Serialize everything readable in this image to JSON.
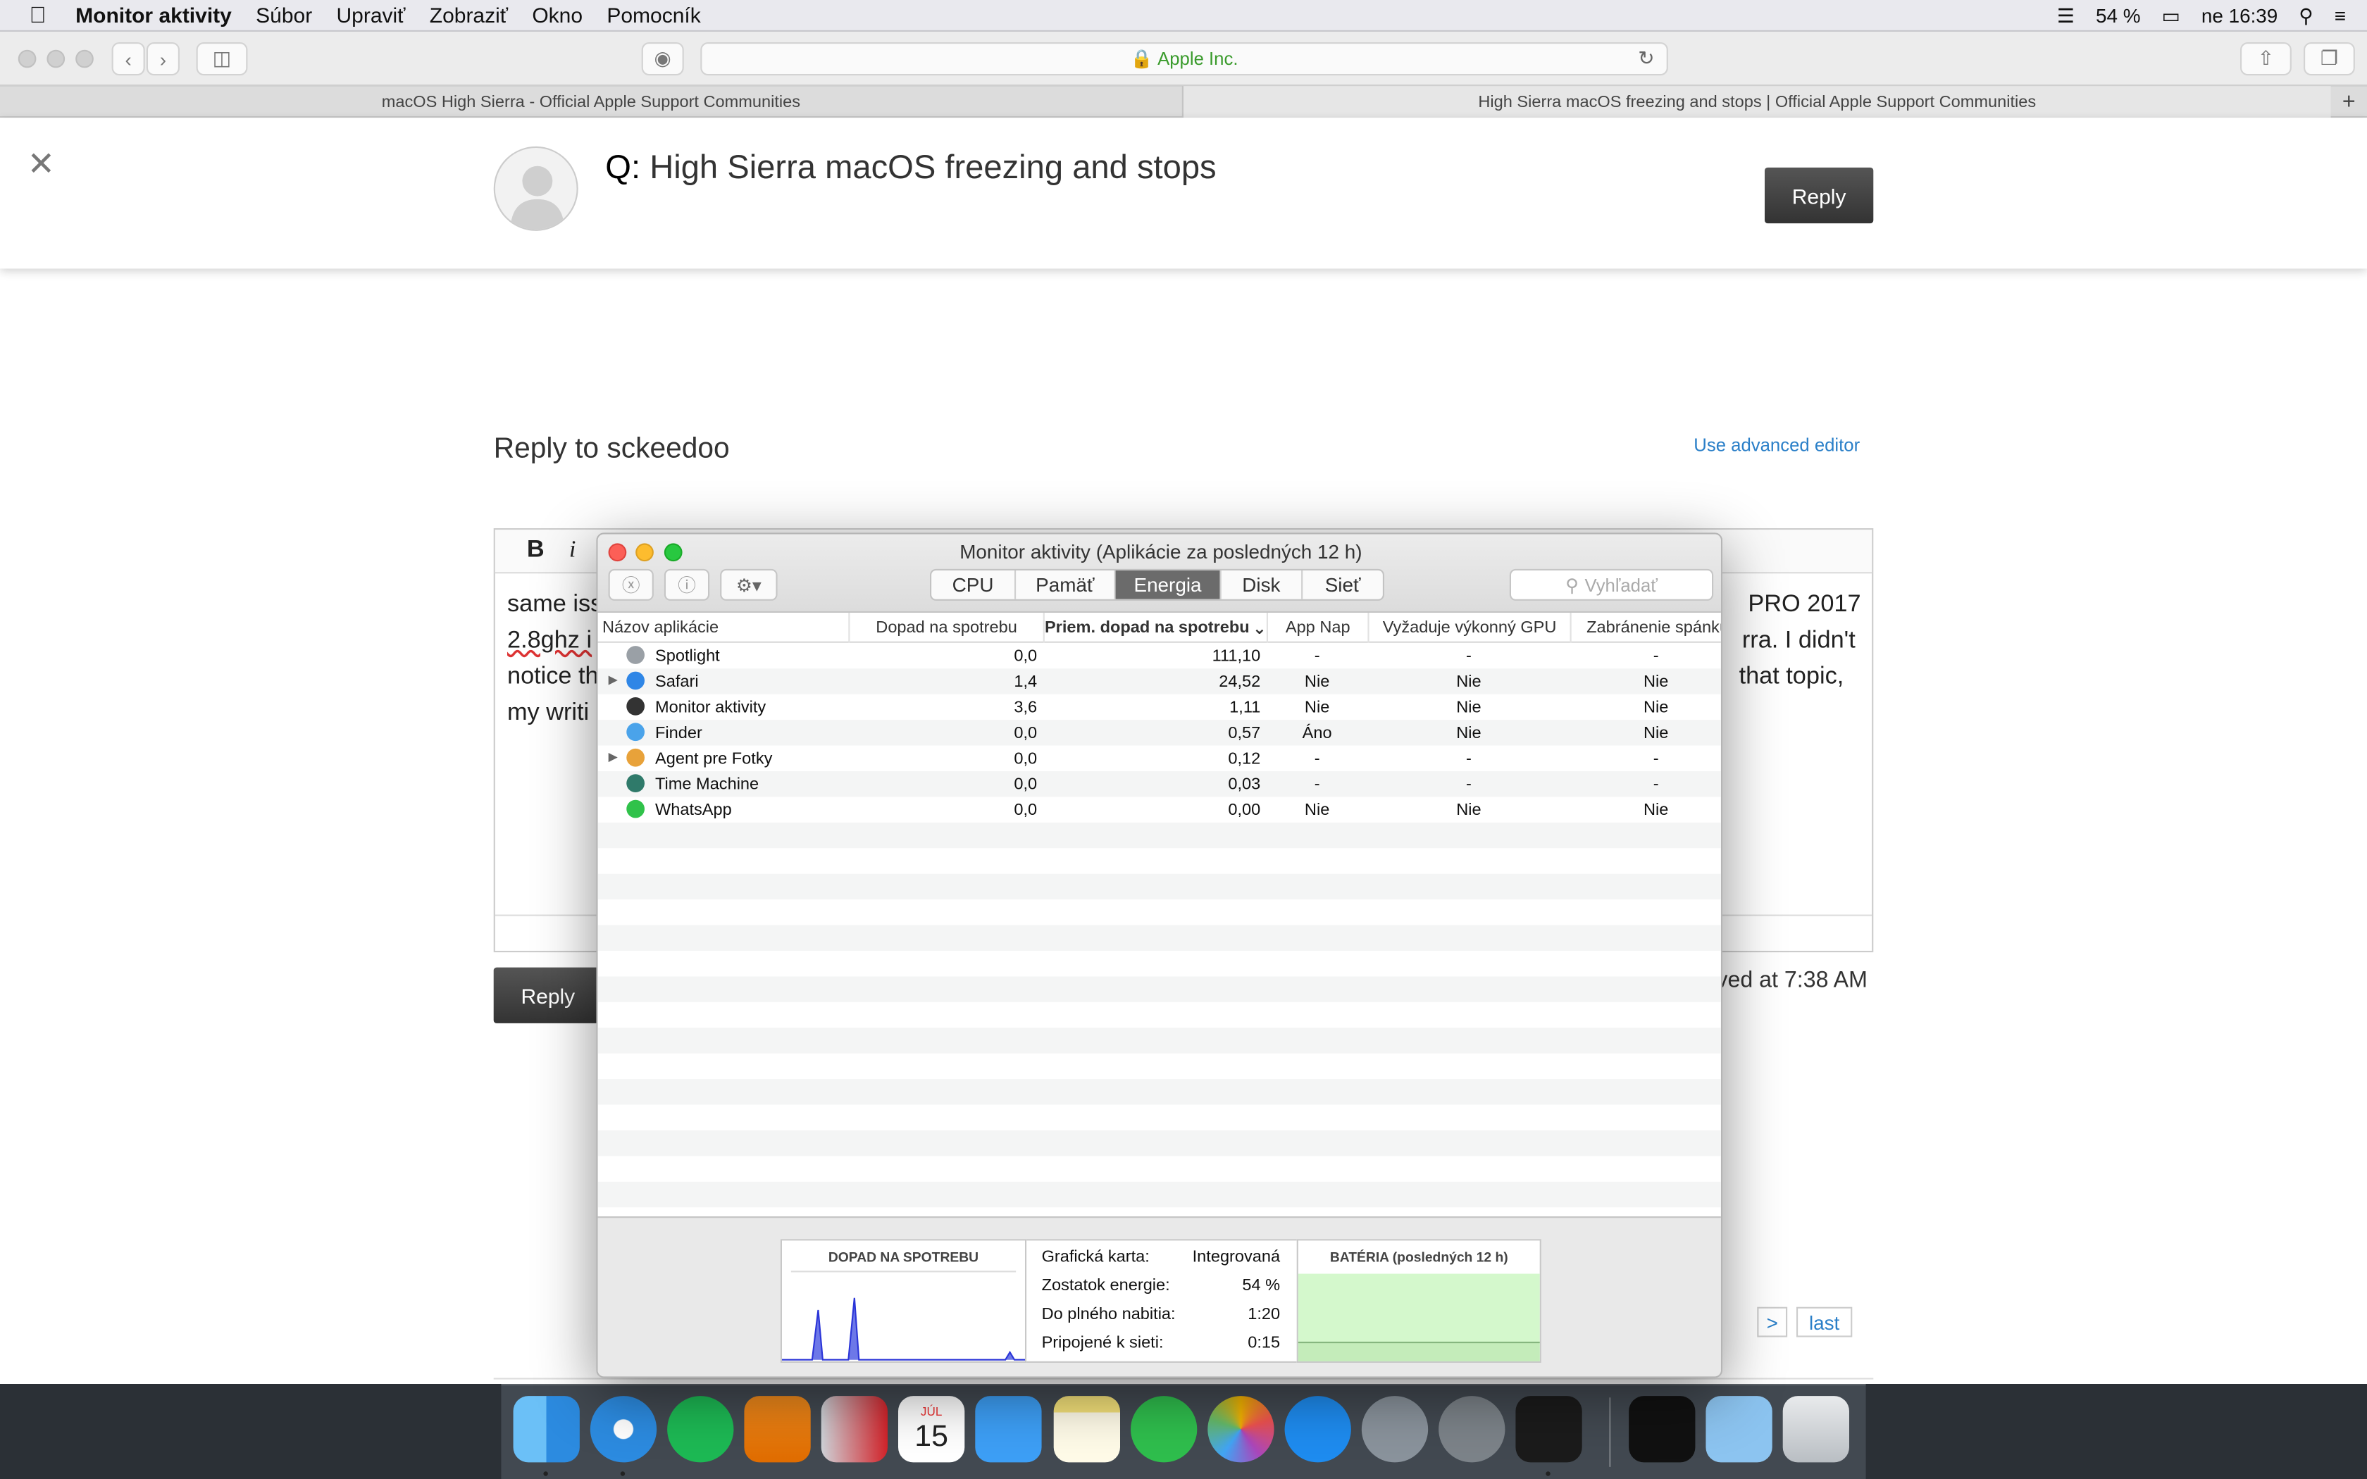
{
  "menubar": {
    "app": "Monitor aktivity",
    "items": [
      "Súbor",
      "Upraviť",
      "Zobraziť",
      "Okno",
      "Pomocník"
    ],
    "battery": "54 %",
    "clock": "ne 16:39"
  },
  "safari": {
    "url": "Apple Inc.",
    "tabs": [
      "macOS High Sierra - Official Apple Support Communities",
      "High Sierra macOS freezing and stops | Official Apple Support Communities"
    ]
  },
  "page": {
    "question_prefix": "Q:",
    "question": "High Sierra macOS freezing and stops",
    "reply_button": "Reply",
    "reply_to": "Reply to sckeedoo",
    "advanced_editor": "Use advanced editor",
    "editor_lines_left": [
      "same iss",
      "2.8ghz i",
      "notice th",
      "my writi"
    ],
    "editor_lines_right": [
      "PRO 2017",
      "rra. I didn't",
      "that topic,",
      ""
    ],
    "bold_button": "B",
    "italic_button": "i",
    "saved_text": "ved at 7:38 AM",
    "pager_prev": ")",
    "pager_next": ">",
    "pager_last": "last"
  },
  "activity_monitor": {
    "title": "Monitor aktivity (Aplikácie za posledných 12 h)",
    "tabs": [
      {
        "label": "CPU",
        "active": false
      },
      {
        "label": "Pamäť",
        "active": false
      },
      {
        "label": "Energia",
        "active": true
      },
      {
        "label": "Disk",
        "active": false
      },
      {
        "label": "Sieť",
        "active": false
      }
    ],
    "search_placeholder": "Vyhľadať",
    "columns": [
      "Názov aplikácie",
      "Dopad na spotrebu",
      "Priem. dopad na spotrebu",
      "App Nap",
      "Vyžaduje výkonný GPU",
      "Zabránenie spánku"
    ],
    "rows": [
      {
        "name": "Spotlight",
        "impact": "0,0",
        "avg": "111,10",
        "nap": "-",
        "gpu": "-",
        "sleep": "-",
        "icon_color": "#9aa0a6",
        "expand": false
      },
      {
        "name": "Safari",
        "impact": "1,4",
        "avg": "24,52",
        "nap": "Nie",
        "gpu": "Nie",
        "sleep": "Nie",
        "icon_color": "#2f86e6",
        "expand": true
      },
      {
        "name": "Monitor aktivity",
        "impact": "3,6",
        "avg": "1,11",
        "nap": "Nie",
        "gpu": "Nie",
        "sleep": "Nie",
        "icon_color": "#333333",
        "expand": false
      },
      {
        "name": "Finder",
        "impact": "0,0",
        "avg": "0,57",
        "nap": "Áno",
        "gpu": "Nie",
        "sleep": "Nie",
        "icon_color": "#4aa3ea",
        "expand": false
      },
      {
        "name": "Agent pre Fotky",
        "impact": "0,0",
        "avg": "0,12",
        "nap": "-",
        "gpu": "-",
        "sleep": "-",
        "icon_color": "#e8a23a",
        "expand": true
      },
      {
        "name": "Time Machine",
        "impact": "0,0",
        "avg": "0,03",
        "nap": "-",
        "gpu": "-",
        "sleep": "-",
        "icon_color": "#2f7a6a",
        "expand": false
      },
      {
        "name": "WhatsApp",
        "impact": "0,0",
        "avg": "0,00",
        "nap": "Nie",
        "gpu": "Nie",
        "sleep": "Nie",
        "icon_color": "#30c24a",
        "expand": false
      }
    ],
    "bottom": {
      "impact_title": "DOPAD NA SPOTREBU",
      "info": [
        {
          "k": "Grafická karta:",
          "v": "Integrovaná"
        },
        {
          "k": "Zostatok energie:",
          "v": "54 %"
        },
        {
          "k": "Do plného nabitia:",
          "v": "1:20"
        },
        {
          "k": "Pripojené k sieti:",
          "v": "0:15"
        }
      ],
      "battery_title": "BATÉRIA (posledných 12 h)",
      "battery_level_fraction": 0.54
    }
  },
  "dock": {
    "icons": [
      "finder-icon",
      "safari-icon",
      "spotify-icon",
      "vlc-icon",
      "parallels-icon",
      "calendar-icon",
      "messages-icon",
      "notes-icon",
      "whatsapp-icon",
      "photos-icon",
      "app-store-icon",
      "launchpad-icon",
      "system-preferences-icon",
      "activity-monitor-icon",
      "screenshot-icon",
      "folder-icon",
      "trash-icon"
    ],
    "calendar_day": "15",
    "calendar_month": "JÚL"
  },
  "colors": {
    "link": "#2a7fc8",
    "accent_segment": "#6b6b6b",
    "battery_green": "#d4f8cc",
    "graph_blue": "#2b35d8"
  }
}
